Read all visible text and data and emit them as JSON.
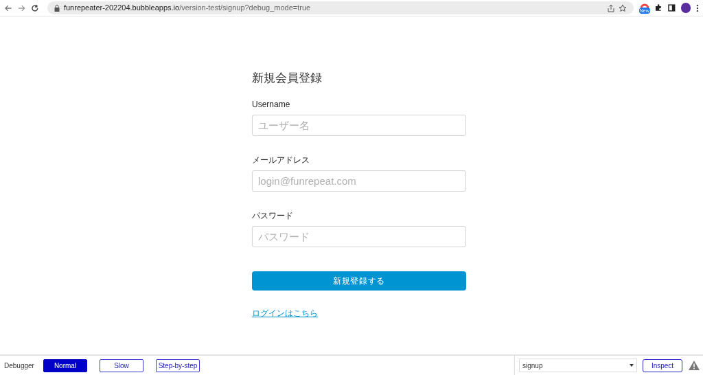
{
  "browser": {
    "url_host": "funrepeater-202204.bubbleapps.io",
    "url_path": "/version-test/signup?debug_mode=true",
    "extension_badge": "New"
  },
  "form": {
    "title": "新規会員登録",
    "fields": [
      {
        "label": "Username",
        "placeholder": "ユーザー名"
      },
      {
        "label": "メールアドレス",
        "placeholder": "login@funrepeat.com"
      },
      {
        "label": "パスワード",
        "placeholder": "パスワード"
      }
    ],
    "submit": "新規登録する",
    "login_link": "ログインはこちら"
  },
  "debugger": {
    "label": "Debugger",
    "modes": [
      {
        "label": "Normal",
        "selected": true
      },
      {
        "label": "Slow",
        "selected": false
      },
      {
        "label": "Step-by-step",
        "selected": false
      }
    ],
    "page_select": "signup",
    "inspect": "Inspect"
  }
}
